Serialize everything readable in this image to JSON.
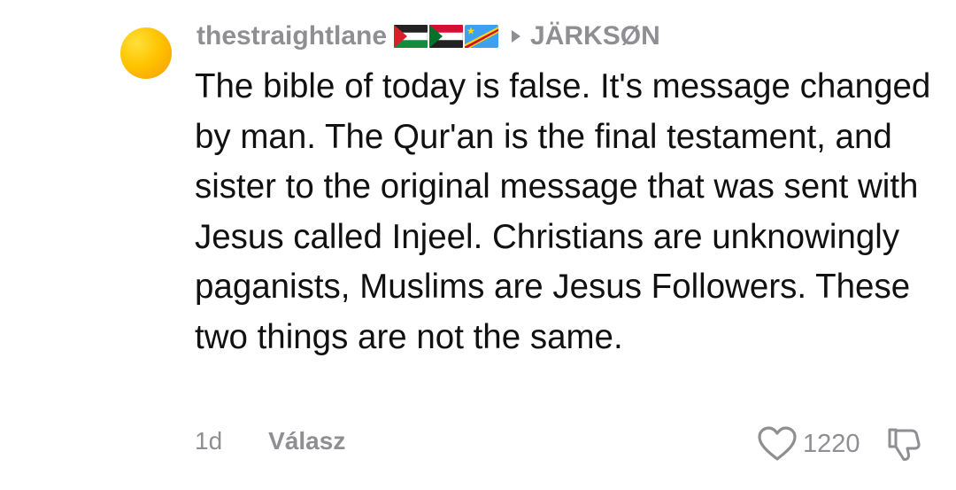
{
  "comment": {
    "avatar_icon": "user-avatar",
    "username": "thestraightlane",
    "flags": [
      "palestine-flag",
      "sudan-flag",
      "dr-congo-flag"
    ],
    "reply_arrow_icon": "caret-right-icon",
    "reply_to": "JÄRKSØN",
    "text": "The bible of today is false. It's message changed by man. The Qur'an is the final testament, and sister to the original message that was sent with Jesus called Injeel. Christians are unknowingly paganists, Muslims are Jesus Followers. These two things are not the same.",
    "time": "1d",
    "reply_label": "Válasz",
    "like_icon": "heart-icon",
    "like_count": "1220",
    "dislike_icon": "thumbs-down-icon"
  },
  "colors": {
    "meta_text": "#8e8e93",
    "body_text": "#111111",
    "avatar_gradient": [
      "#ffe03a",
      "#ffc400",
      "#f79a06"
    ]
  }
}
